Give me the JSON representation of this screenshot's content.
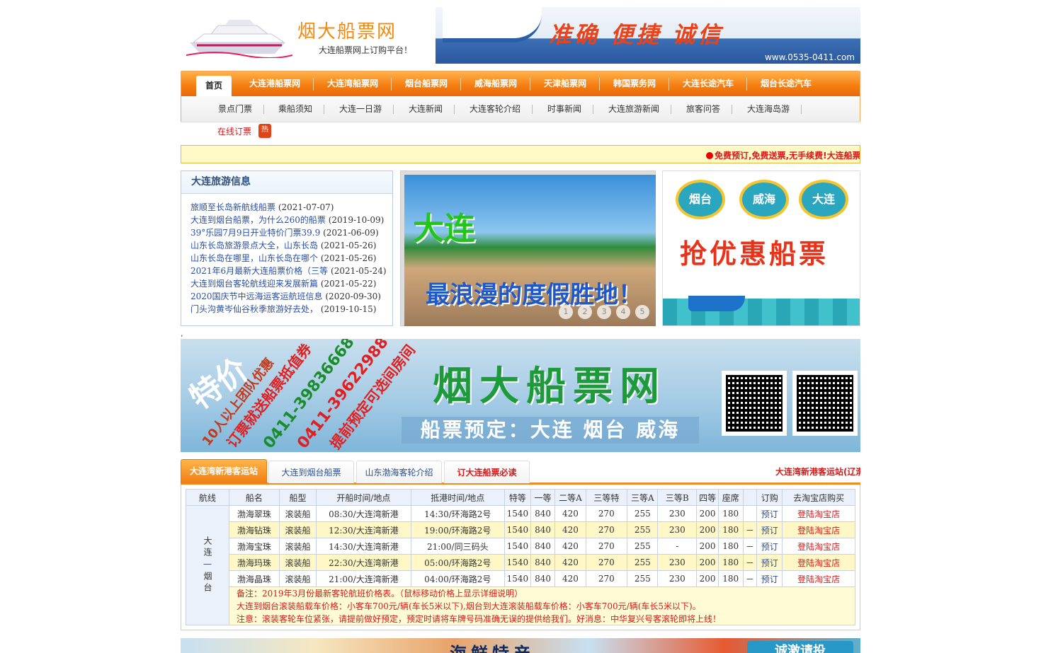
{
  "header": {
    "logo_text": "烟大船票网",
    "slogan": "大连船票网上订购平台！",
    "banner_slogan": "准确  便捷  诚信",
    "banner_url": "www.0535-0411.com"
  },
  "nav": {
    "main": [
      "首页",
      "大连港船票网",
      "大连湾船票网",
      "烟台船票网",
      "威海船票网",
      "天津船票网",
      "韩国票务网",
      "大连长途汽车",
      "烟台长途汽车"
    ],
    "sub": [
      "景点门票",
      "乘船须知",
      "大连一日游",
      "大连新闻",
      "大连客轮介绍",
      "时事新闻",
      "大连旅游新闻",
      "旅客问答",
      "大连海岛游"
    ],
    "online": "在线订票",
    "hot": "热"
  },
  "notice": "免费预订,免费送票,无手续费!大连船票",
  "info": {
    "title": "大连旅游信息",
    "items": [
      {
        "title": "旅顺至长岛新航线船票",
        "date": "(2021-07-07)"
      },
      {
        "title": "大连到烟台船票，为什么260的船票",
        "date": "(2019-10-09)"
      },
      {
        "title": "39°乐园7月9日开业特价门票39.9",
        "date": "(2021-06-09)"
      },
      {
        "title": "山东长岛旅游景点大全，山东长岛",
        "date": "(2021-05-26)"
      },
      {
        "title": "山东长岛在哪里，山东长岛在哪个",
        "date": "(2021-05-26)"
      },
      {
        "title": "2021年6月最新大连船票价格（三等",
        "date": "(2021-05-24)"
      },
      {
        "title": "大连到烟台客轮航线迎来发展新篇",
        "date": "(2021-05-22)"
      },
      {
        "title": "2020国庆节中远海运客运航班信息",
        "date": "(2020-09-30)"
      },
      {
        "title": "门头沟黄岑仙谷秋季旅游好去处，",
        "date": "(2019-10-15)"
      }
    ]
  },
  "slider": {
    "title": "大连",
    "subtitle": "最浪漫的度假胜地！",
    "dots": [
      "1",
      "2",
      "3",
      "4",
      "5"
    ]
  },
  "promo": {
    "badges": [
      "烟台",
      "威海",
      "大连"
    ],
    "headline": "抢优惠船票"
  },
  "comma": ",",
  "big_banner": {
    "tejia": "特价",
    "line1": "10人以上团队优惠",
    "line2": "订票就送船票抵值券",
    "line3": "0411-39836668",
    "line4": "0411-39622988",
    "line5": "提前预定可选间房间",
    "title": "烟大船票网",
    "sub": "船票预定：大连  烟台  威海"
  },
  "tabs": [
    "大连湾新港客运站",
    "大连到烟台船票",
    "山东渤海客轮介绍",
    "订大连船票必读"
  ],
  "tab_scroll": "大连湾新港客运站(辽渤",
  "table": {
    "headers": [
      "航线",
      "船名",
      "船型",
      "开船时间/地点",
      "抵港时间/地点",
      "特等",
      "一等",
      "二等A",
      "三等特",
      "三等A",
      "三等B",
      "四等",
      "座席",
      "",
      "订购",
      "去淘宝店购买"
    ],
    "route": "大连—烟台",
    "rows": [
      [
        "渤海翠珠",
        "滚装船",
        "08:30/大连湾新港",
        "14:30/环海路2号",
        "1540",
        "840",
        "420",
        "270",
        "255",
        "230",
        "200",
        "180",
        "",
        "预订",
        "登陆淘宝店"
      ],
      [
        "渤海钻珠",
        "滚装船",
        "12:30/大连湾新港",
        "19:00/环海路2号",
        "1540",
        "840",
        "420",
        "270",
        "255",
        "230",
        "200",
        "180",
        "－",
        "预订",
        "登陆淘宝店"
      ],
      [
        "渤海宝珠",
        "滚装船",
        "14:30/大连湾新港",
        "21:00/同三码头",
        "1540",
        "840",
        "420",
        "270",
        "255",
        "-",
        "200",
        "180",
        "－",
        "预订",
        "登陆淘宝店"
      ],
      [
        "渤海玛珠",
        "滚装船",
        "22:30/大连湾新港",
        "05:00/环海路2号",
        "1540",
        "840",
        "420",
        "270",
        "255",
        "230",
        "200",
        "180",
        "－",
        "预订",
        "登陆淘宝店"
      ],
      [
        "渤海晶珠",
        "滚装船",
        "21:00/大连湾新港",
        "04:00/环海路2号",
        "1540",
        "840",
        "420",
        "270",
        "255",
        "230",
        "200",
        "180",
        "－",
        "预订",
        "登陆淘宝店"
      ]
    ],
    "notes": [
      "备注：2019年3月份最新客轮航班价格表。（鼠标移动价格上显示详细说明）",
      "大连到烟台滚装船载车价格：小客车700元/辆(车长5米以下),烟台到大连滚装船载车价格：小客车700元/辆(车长5米以下)。",
      "注意：滚装客轮车位紧张，请提前做好预定，预定时请将车牌号码准确无误的提供给我们。好消息：中华复兴号客滚轮即将上线！"
    ]
  },
  "bottom_banner": {
    "title": "海鲜特产",
    "right": "诚激请投"
  },
  "colors": {
    "accent": "#f47c10",
    "link": "#2a4fa1",
    "red": "#d21c1c",
    "highlight": "#fff8c6"
  }
}
